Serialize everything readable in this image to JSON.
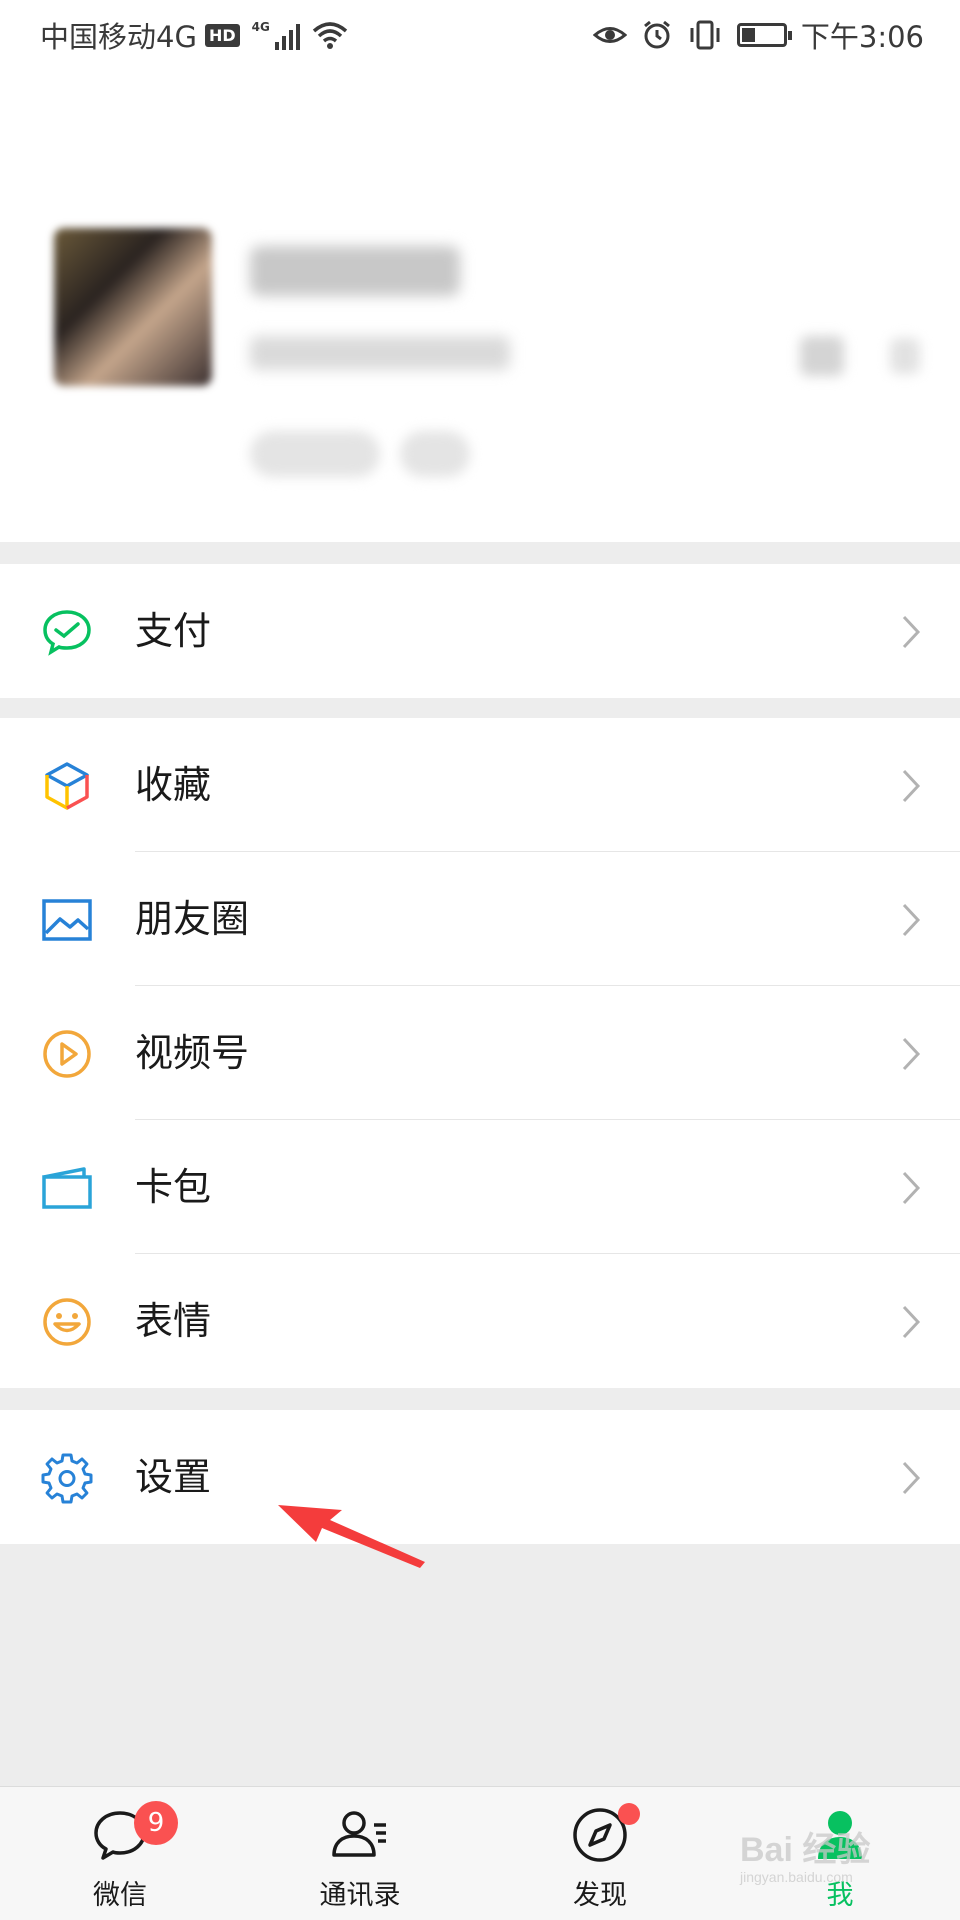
{
  "status_bar": {
    "carrier": "中国移动4G",
    "hd": "HD",
    "net_tag": "4G",
    "time": "下午3:06"
  },
  "menu": {
    "pay": {
      "label": "支付",
      "icon": "wechat-pay-icon"
    },
    "items": [
      {
        "label": "收藏",
        "icon": "favorites-cube-icon"
      },
      {
        "label": "朋友圈",
        "icon": "moments-picture-icon"
      },
      {
        "label": "视频号",
        "icon": "channels-play-icon"
      },
      {
        "label": "卡包",
        "icon": "card-wallet-icon"
      },
      {
        "label": "表情",
        "icon": "sticker-smile-icon"
      }
    ],
    "settings": {
      "label": "设置",
      "icon": "gear-icon"
    }
  },
  "tabbar": {
    "tabs": [
      {
        "label": "微信",
        "badge": "9",
        "icon": "chat-bubble-icon"
      },
      {
        "label": "通讯录",
        "icon": "contacts-icon"
      },
      {
        "label": "发现",
        "icon": "compass-icon"
      },
      {
        "label": "我",
        "icon": "person-icon"
      }
    ],
    "active_color": "#07c160",
    "badge_color": "#fa5151"
  },
  "watermark": {
    "text": "Bai 经验",
    "sub": "jingyan.baidu.com"
  }
}
